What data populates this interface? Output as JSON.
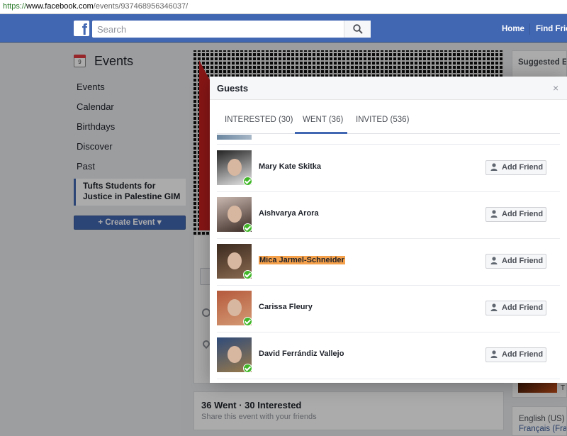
{
  "browser": {
    "url_protocol": "https://",
    "url_host": "www.facebook.com",
    "url_path": "/events/937468956346037/"
  },
  "topbar": {
    "logo": "f",
    "search_placeholder": "Search",
    "nav": {
      "home": "Home",
      "find_friends": "Find Frie"
    }
  },
  "sidebar": {
    "calendar_day": "9",
    "title": "Events",
    "items": [
      "Events",
      "Calendar",
      "Birthdays",
      "Discover",
      "Past"
    ],
    "active_event": "Tufts Students for Justice in Palestine GIM",
    "create_button": "+ Create Event ▾"
  },
  "main": {
    "stats_title": "36 Went · 30 Interested",
    "stats_sub": "Share this event with your friends"
  },
  "right": {
    "suggested": "Suggested Ev",
    "partial": "T",
    "language_current": "English (US)",
    "language_alt": "Français (Fran"
  },
  "modal": {
    "title": "Guests",
    "close": "×",
    "tabs": [
      {
        "label": "INTERESTED (30)",
        "active": false
      },
      {
        "label": "WENT (36)",
        "active": true
      },
      {
        "label": "INVITED (536)",
        "active": false
      }
    ],
    "add_friend_label": "Add Friend",
    "guests": [
      {
        "name": "Mary Kate Skitka",
        "highlighted": false,
        "photo_colors": [
          "#222222",
          "#e8e8e8"
        ]
      },
      {
        "name": "Aishvarya Arora",
        "highlighted": false,
        "photo_colors": [
          "#c9b8b0",
          "#3a2a24"
        ]
      },
      {
        "name": "Mica Jarmel-Schneider",
        "highlighted": true,
        "photo_colors": [
          "#3b2a1f",
          "#8a6a50"
        ]
      },
      {
        "name": "Carissa Fleury",
        "highlighted": false,
        "photo_colors": [
          "#b55a3c",
          "#d49a74"
        ]
      },
      {
        "name": "David Ferrándiz Vallejo",
        "highlighted": false,
        "photo_colors": [
          "#2f4b7a",
          "#9a7a4a"
        ]
      }
    ]
  }
}
